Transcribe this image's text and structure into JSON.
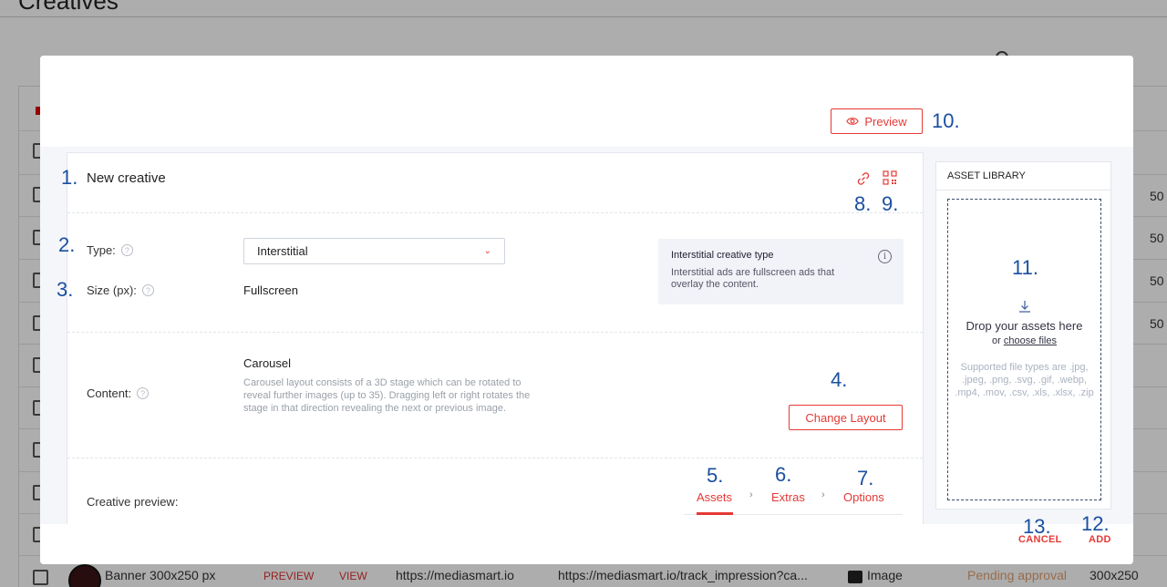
{
  "background": {
    "page_title": "Creatives",
    "row": {
      "name": "Banner 300x250 px",
      "preview_link": "PREVIEW",
      "view_link": "VIEW",
      "click_url": "https://mediasmart.io",
      "impression_url": "https://mediasmart.io/track_impression?ca...",
      "type": "Image",
      "status": "Pending approval",
      "size": "300x250"
    },
    "right_column_values": [
      "50",
      "50",
      "50",
      "50"
    ]
  },
  "modal": {
    "preview_label": "Preview",
    "card_title": "New creative",
    "type_label": "Type:",
    "type_value": "Interstitial",
    "size_label": "Size (px):",
    "size_value": "Fullscreen",
    "info": {
      "title": "Interstitial creative type",
      "text": "Interstitial ads are fullscreen ads that overlay the content."
    },
    "content_label": "Content:",
    "content_title": "Carousel",
    "content_description": "Carousel layout consists of a 3D stage which can be rotated to reveal further images (up to 35). Dragging left or right rotates the stage in that direction revealing the next or previous image.",
    "change_layout_label": "Change Layout",
    "creative_preview_label": "Creative preview:",
    "tabs": [
      {
        "label": "Assets",
        "active": true
      },
      {
        "label": "Extras",
        "active": false
      },
      {
        "label": "Options",
        "active": false
      }
    ],
    "asset_library": {
      "title": "ASSET LIBRARY",
      "drop_text": "Drop your assets here",
      "or_text": "or",
      "choose_files": "choose files",
      "supported_types": "Supported file types are .jpg, .jpeg, .png, .svg, .gif, .webp, .mp4, .mov, .csv, .xls, .xlsx, .zip"
    },
    "footer": {
      "cancel_label": "CANCEL",
      "add_label": "ADD"
    }
  },
  "annotations": [
    "1.",
    "2.",
    "3.",
    "4.",
    "5.",
    "6.",
    "7.",
    "8.",
    "9.",
    "10.",
    "11.",
    "12.",
    "13."
  ],
  "colors": {
    "accent": "#e53935",
    "annotation": "#1a4fa0",
    "overlay": "rgba(0,0,0,0.32)"
  },
  "icons": [
    "eye-icon",
    "link-icon",
    "qr-code-icon",
    "help-icon",
    "info-icon",
    "chevron-down-icon",
    "download-icon",
    "search-icon",
    "image-icon"
  ]
}
